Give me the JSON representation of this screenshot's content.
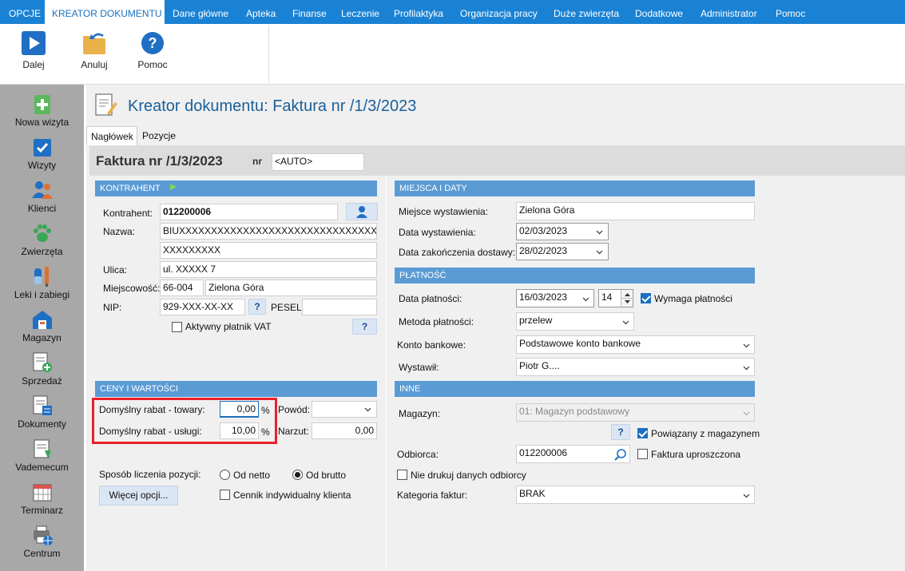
{
  "menu": {
    "items": [
      "OPCJE",
      "KREATOR DOKUMENTU",
      "Dane główne",
      "Apteka",
      "Finanse",
      "Leczenie",
      "Profilaktyka",
      "Organizacja pracy",
      "Duże zwierzęta",
      "Dodatkowe",
      "Administrator",
      "Pomoc"
    ],
    "active": "KREATOR DOKUMENTU"
  },
  "ribbon": {
    "next": "Dalej",
    "cancel": "Anuluj",
    "help": "Pomoc"
  },
  "sidebar": {
    "items": [
      "Nowa wizyta",
      "Wizyty",
      "Klienci",
      "Zwierzęta",
      "Leki i zabiegi",
      "Magazyn",
      "Sprzedaż",
      "Dokumenty",
      "Vademecum",
      "Terminarz",
      "Centrum"
    ]
  },
  "page": {
    "title": "Kreator dokumentu: Faktura nr  /1/3/2023"
  },
  "tabs": {
    "header": "Nagłówek",
    "positions": "Pozycje"
  },
  "header": {
    "doc_title": "Faktura nr  /1/3/2023",
    "nr_label": "nr",
    "nr_value": "<AUTO>"
  },
  "kontrahent": {
    "section": "KONTRAHENT",
    "label_kontrahent": "Kontrahent:",
    "value_kontrahent": "012200006",
    "label_nazwa": "Nazwa:",
    "nazwa1": "BIUXXXXXXXXXXXXXXXXXXXXXXXXXXXXXXXXXXXXXX",
    "nazwa2": "XXXXXXXXX",
    "label_ulica": "Ulica:",
    "ulica": "ul. XXXXX 7",
    "label_miejscowosc": "Miejscowość:",
    "kod": "66-004",
    "miasto": "Zielona Góra",
    "label_nip": "NIP:",
    "nip": "929-XXX-XX-XX",
    "label_pesel": "PESEL:",
    "pesel": "",
    "vat_label": "Aktywny płatnik VAT",
    "q": "?"
  },
  "ceny": {
    "section": "CENY I WARTOŚCI",
    "rabat_towary_label": "Domyślny rabat - towary:",
    "rabat_towary": "0,00",
    "rabat_uslugi_label": "Domyślny rabat - usługi:",
    "rabat_uslugi": "10,00",
    "pct": "%",
    "powod_label": "Powód:",
    "narzut_label": "Narzut:",
    "narzut": "0,00",
    "sposob_label": "Sposób liczenia pozycji:",
    "od_netto": "Od netto",
    "od_brutto": "Od brutto",
    "cennik": "Cennik indywidualny klienta",
    "wiecej": "Więcej opcji..."
  },
  "miejsca": {
    "section": "MIEJSCA I DATY",
    "miejsce_label": "Miejsce wystawienia:",
    "miejsce": "Zielona Góra",
    "data_wyst_label": "Data wystawienia:",
    "data_wyst": "02/03/2023",
    "data_dost_label": "Data zakończenia dostawy:",
    "data_dost": "28/02/2023"
  },
  "platnosc": {
    "section": "PŁATNOŚĆ",
    "data_plat_label": "Data płatności:",
    "data_plat": "16/03/2023",
    "dni": "14",
    "wymaga": "Wymaga płatności",
    "metoda_label": "Metoda płatności:",
    "metoda": "przelew",
    "konto_label": "Konto bankowe:",
    "konto": "Podstawowe konto bankowe",
    "wystawil_label": "Wystawił:",
    "wystawil": "Piotr G...."
  },
  "inne": {
    "section": "INNE",
    "magazyn_label": "Magazyn:",
    "magazyn": "01: Magazyn podstawowy",
    "powiazany": "Powiązany z magazynem",
    "odbiorca_label": "Odbiorca:",
    "odbiorca": "012200006",
    "faktura_upr": "Faktura uproszczona",
    "nie_drukuj": "Nie drukuj danych odbiorcy",
    "kategoria_label": "Kategoria faktur:",
    "kategoria": "BRAK",
    "q": "?"
  }
}
